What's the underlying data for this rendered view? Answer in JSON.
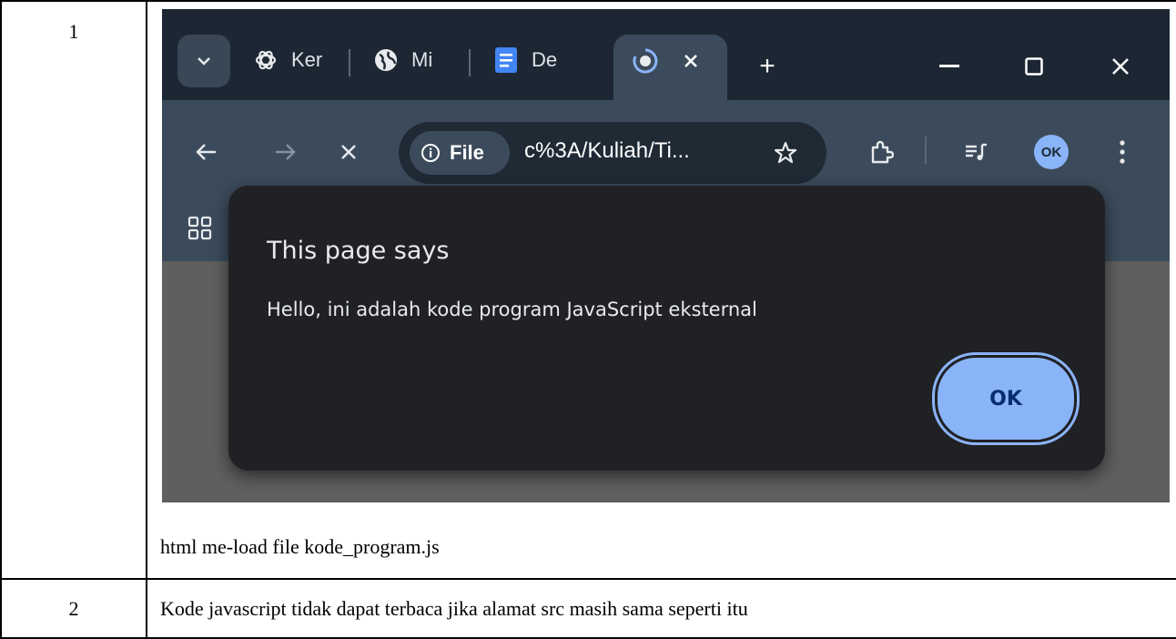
{
  "table": {
    "row1": {
      "number": "1",
      "caption": "html me-load file kode_program.js"
    },
    "row2": {
      "number": "2",
      "text": "Kode javascript tidak dapat terbaca jika alamat src masih sama seperti itu"
    }
  },
  "browser": {
    "tabs": [
      {
        "label": "Ker",
        "icon": "openai-icon"
      },
      {
        "label": "Mi",
        "icon": "globe-icon"
      },
      {
        "label": "De",
        "icon": "docs-icon"
      },
      {
        "label": "",
        "icon": "loading-tab-icon",
        "active": true
      }
    ],
    "new_tab_label": "+",
    "omnibox": {
      "chip_label": "File",
      "url": "c%3A/Kuliah/Ti..."
    },
    "avatar_text": "OK",
    "colors": {
      "titlebar": "#1c2733",
      "toolbar": "#3b4b5b",
      "dialog": "#202124",
      "accent": "#8ab4f8"
    }
  },
  "dialog": {
    "title": "This page says",
    "message": "Hello, ini adalah kode program JavaScript eksternal",
    "ok_label": "OK"
  }
}
